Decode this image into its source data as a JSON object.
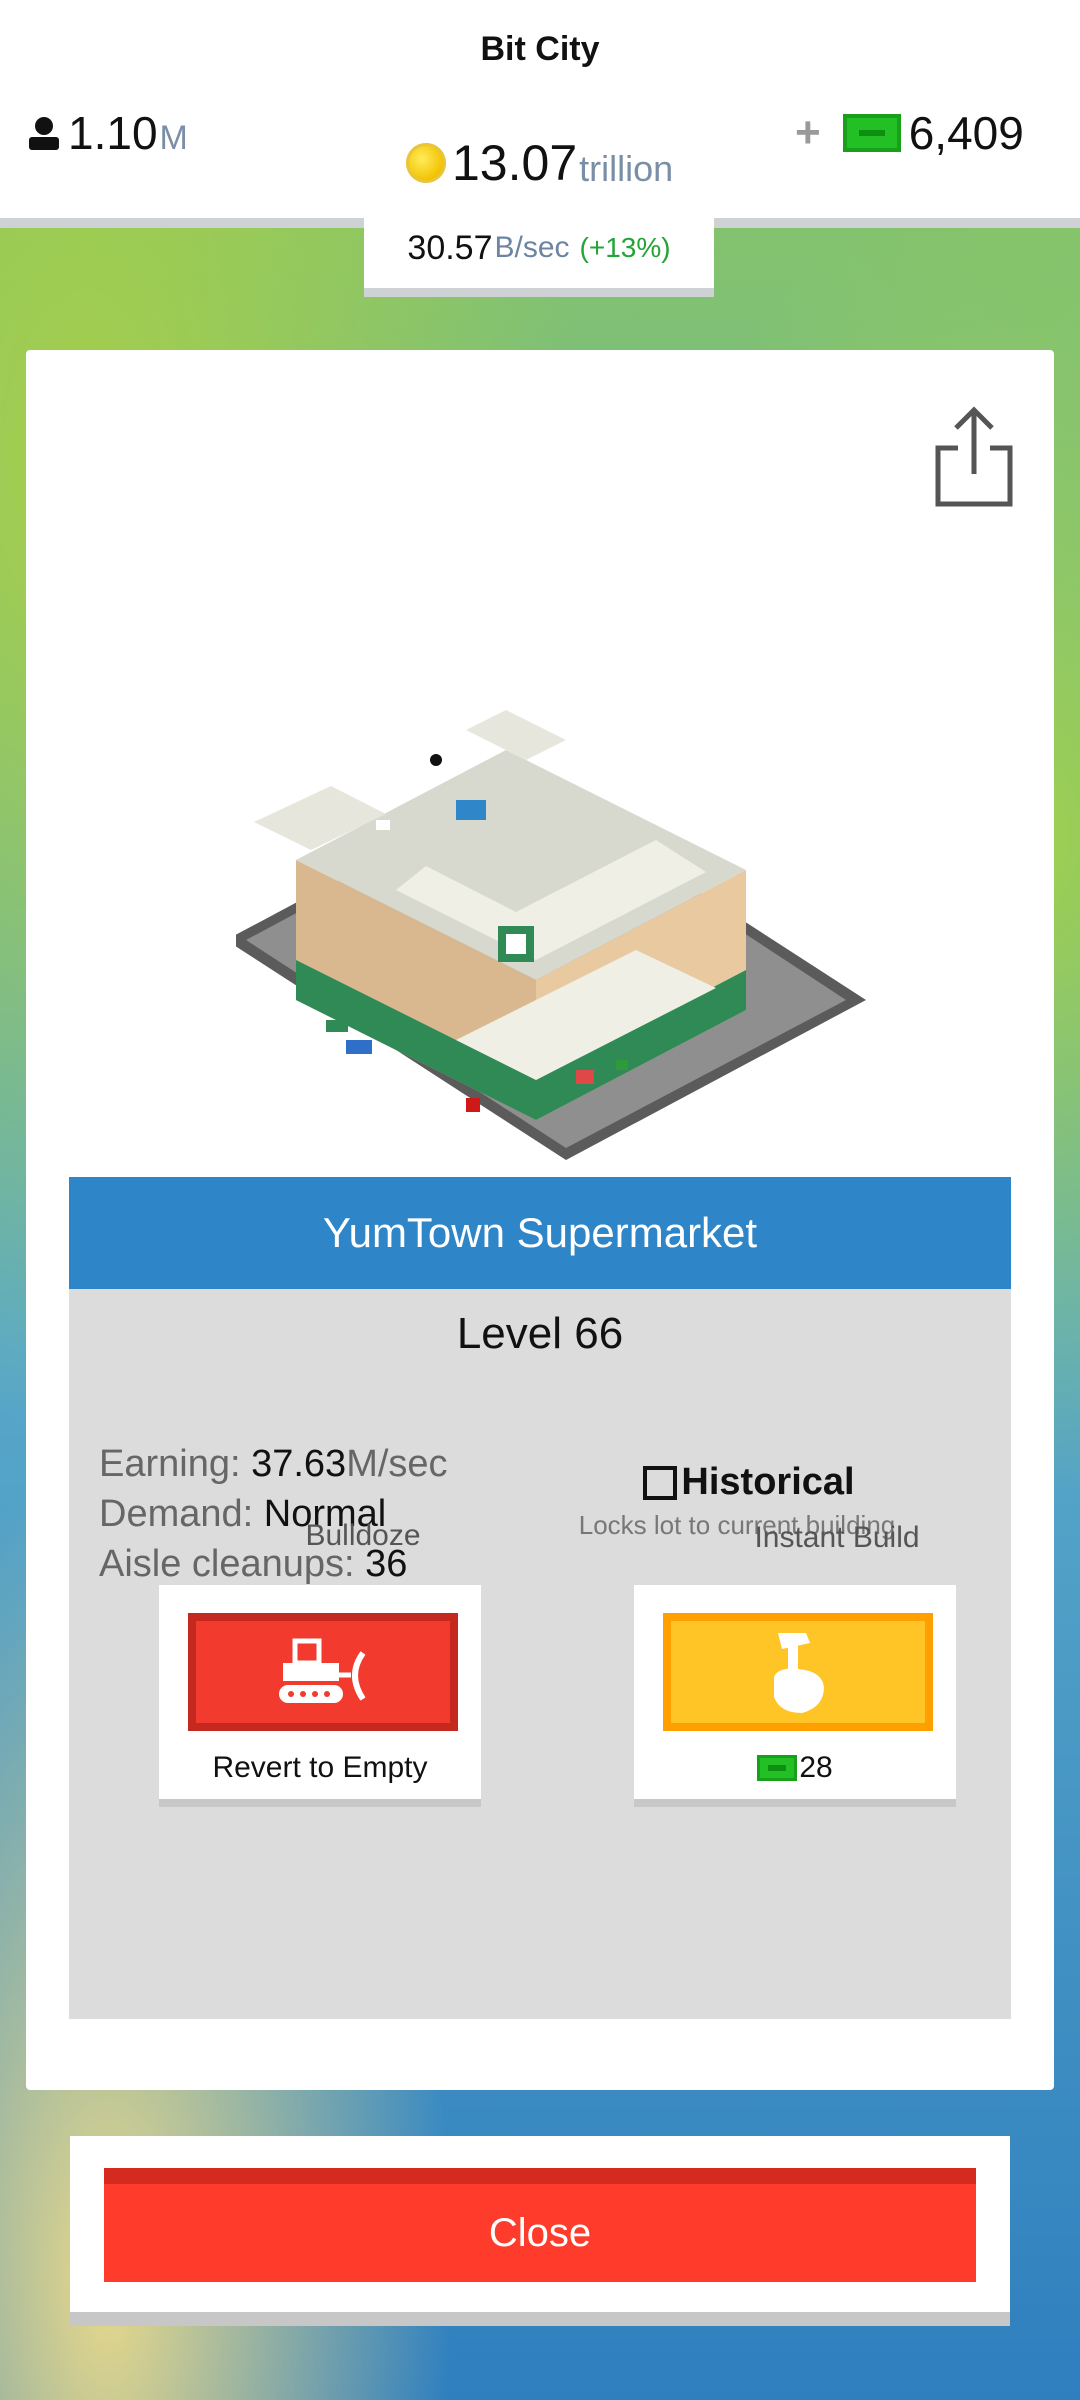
{
  "header": {
    "city_name": "Bit City",
    "population": {
      "value": "1.10",
      "unit": "M"
    },
    "coins": {
      "value": "13.07",
      "unit": "trillion"
    },
    "cash": {
      "plus": "+",
      "value": "6,409"
    },
    "income": {
      "value": "30.57",
      "unit": "B/sec",
      "bonus": "(+13%)"
    }
  },
  "building": {
    "name": "YumTown Supermarket",
    "level": "Level 66",
    "stats": {
      "earning_label": "Earning: ",
      "earning_value": "37.63",
      "earning_unit": "M/sec",
      "demand_label": "Demand: ",
      "demand_value": "Normal",
      "cleanups_label": "Aisle cleanups: ",
      "cleanups_value": "36"
    },
    "historical": {
      "label": "Historical",
      "description": "Locks lot to current building",
      "checked": false
    }
  },
  "actions": {
    "bulldoze": {
      "label": "Bulldoze",
      "caption": "Revert to Empty"
    },
    "instant_build": {
      "label": "Instant Build",
      "cost": "28"
    }
  },
  "close_label": "Close",
  "colors": {
    "title_bar": "#2e86c8",
    "bulldoze_button": "#f23b2e",
    "instant_build_button": "#ffc426",
    "close_button": "#ff3b2b",
    "cash_green": "#22c024"
  },
  "icons": [
    "person-icon",
    "coin-icon",
    "cash-bill-icon",
    "share-icon",
    "bulldozer-icon",
    "hammer-hand-icon"
  ]
}
